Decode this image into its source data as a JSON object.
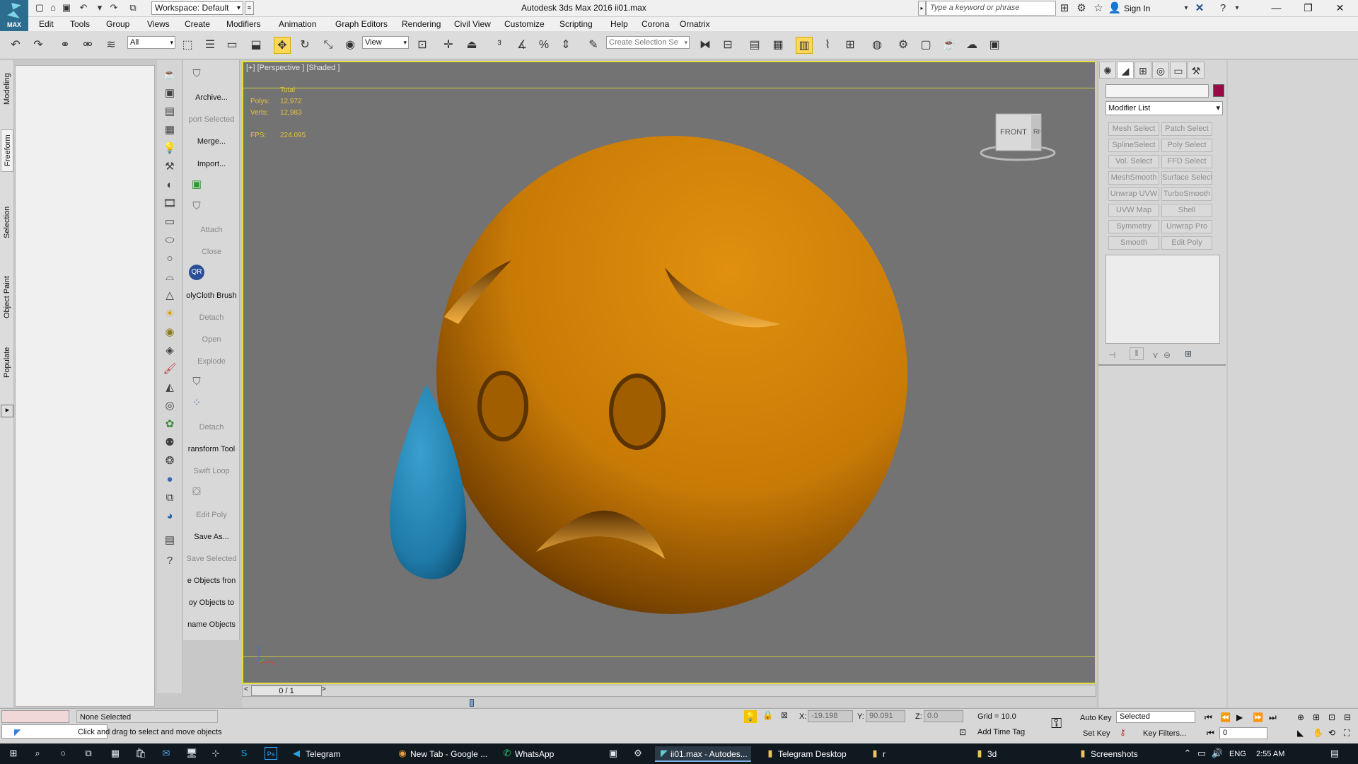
{
  "title_bar": {
    "logo_text": "MAX",
    "workspace": "Workspace: Default",
    "app_title": "Autodesk 3ds Max 2016     ii01.max",
    "search_placeholder": "Type a keyword or phrase",
    "sign_in": "Sign In"
  },
  "menus": [
    "Edit",
    "Tools",
    "Group",
    "Views",
    "Create",
    "Modifiers",
    "Animation",
    "Graph Editors",
    "Rendering",
    "Civil View",
    "Customize",
    "Scripting",
    "Help",
    "Corona",
    "Ornatrix"
  ],
  "main_toolbar": {
    "filter": "All",
    "ref_coord": "View",
    "selection_set_placeholder": "Create Selection Se"
  },
  "ribbon_tabs": [
    "Modeling",
    "Freeform",
    "Selection",
    "Object Paint",
    "Populate"
  ],
  "left_panel_items": [
    {
      "label": "Archive...",
      "disabled": false
    },
    {
      "label": "port Selected",
      "disabled": true
    },
    {
      "label": "Merge...",
      "disabled": false
    },
    {
      "label": "Import...",
      "disabled": false
    },
    {
      "label": "Attach",
      "disabled": true
    },
    {
      "label": "Close",
      "disabled": true
    },
    {
      "label": "olyCloth Brush",
      "disabled": false
    },
    {
      "label": "Detach",
      "disabled": true
    },
    {
      "label": "Open",
      "disabled": true
    },
    {
      "label": "Explode",
      "disabled": true
    },
    {
      "label": "Detach",
      "disabled": true
    },
    {
      "label": "ransform Tool",
      "disabled": false
    },
    {
      "label": "Swift Loop",
      "disabled": true
    },
    {
      "label": "Edit Poly",
      "disabled": true
    },
    {
      "label": "Save As...",
      "disabled": false
    },
    {
      "label": "Save Selected",
      "disabled": true
    },
    {
      "label": "e Objects fron",
      "disabled": false
    },
    {
      "label": "oy Objects to",
      "disabled": false
    },
    {
      "label": "name Objects",
      "disabled": false
    }
  ],
  "viewport": {
    "label": "[+] [Perspective ] [Shaded ]",
    "stats": {
      "total_label": "Total",
      "polys_label": "Polys:",
      "polys": "12,972",
      "verts_label": "Verts:",
      "verts": "12,983",
      "fps_label": "FPS:",
      "fps": "224.095"
    },
    "viewcube_label": "FRONT",
    "viewcube_side": "RIG",
    "colors": {
      "emoji": "#d8860a",
      "drop": "#2a88b8",
      "background": "#737373",
      "frame": "#e7dc3b"
    }
  },
  "timeline": {
    "frame": "0 / 1"
  },
  "command_panel": {
    "modifier_list": "Modifier List",
    "modifier_buttons": [
      "Mesh Select",
      "Patch Select",
      "SplineSelect",
      "Poly Select",
      "Vol. Select",
      "FFD Select",
      "MeshSmooth",
      "Surface Select",
      "Unwrap UVW",
      "TurboSmooth",
      "UVW Map",
      "Shell",
      "Symmetry",
      "Unwrap Pro",
      "Smooth",
      "Edit Poly"
    ]
  },
  "status": {
    "selection": "None Selected",
    "prompt": "Click and drag to select and move objects",
    "x_label": "X:",
    "x": "-19.198",
    "y_label": "Y:",
    "y": "90.091",
    "z_label": "Z:",
    "z": "0.0",
    "grid": "Grid = 10.0",
    "add_time_tag": "Add Time Tag",
    "auto_key": "Auto Key",
    "set_key": "Set Key",
    "key_mode": "Selected",
    "key_filters": "Key Filters...",
    "frame_field": "0"
  },
  "taskbar": {
    "apps": [
      "Telegram",
      "New Tab - Google ...",
      "WhatsApp",
      "ii01.max - Autodes...",
      "Telegram Desktop",
      "r",
      "3d",
      "Screenshots"
    ],
    "lang": "ENG",
    "time": "2:55 AM"
  }
}
